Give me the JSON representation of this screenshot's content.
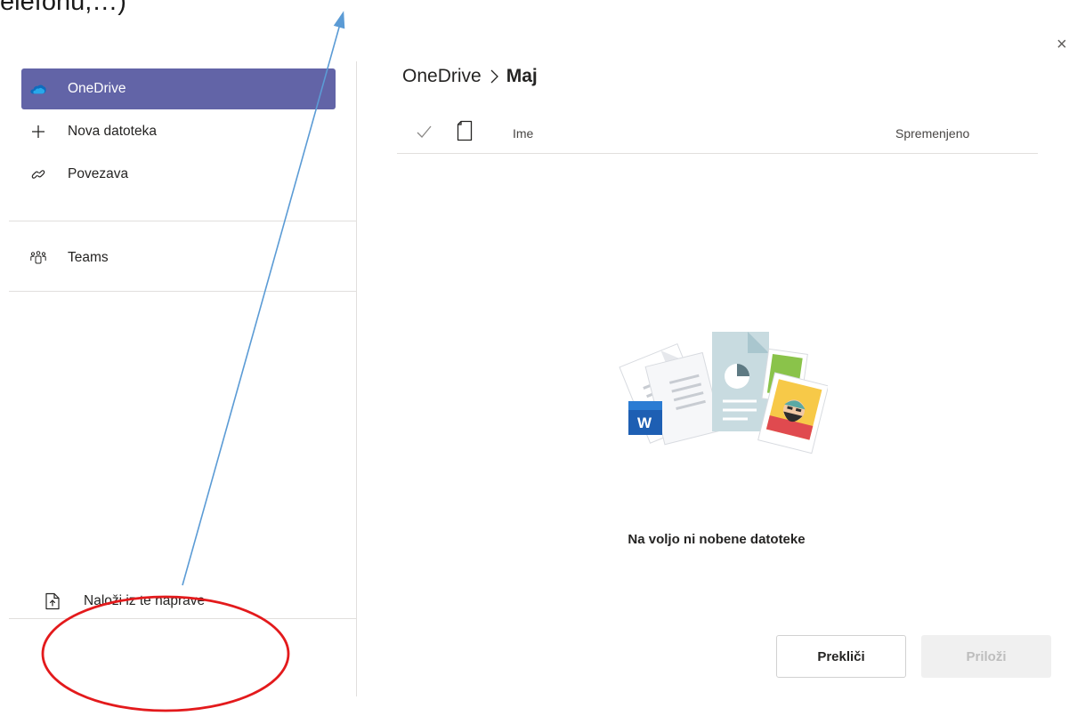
{
  "annotation": {
    "text": "telefonu,…)"
  },
  "close_label": "×",
  "nav": {
    "items": [
      {
        "label": "OneDrive",
        "icon": "onedrive-cloud-icon",
        "active": true
      },
      {
        "label": "Nova datoteka",
        "icon": "plus-icon",
        "active": false
      },
      {
        "label": "Povezava",
        "icon": "link-icon",
        "active": false
      }
    ],
    "teams": {
      "label": "Teams",
      "icon": "teams-icon"
    },
    "upload": {
      "label": "Naloži iz te naprave",
      "icon": "upload-file-icon"
    }
  },
  "breadcrumb": {
    "root": "OneDrive",
    "current": "Maj"
  },
  "table": {
    "columns": {
      "name": "Ime",
      "modified": "Spremenjeno"
    }
  },
  "empty_state": {
    "message": "Na voljo ni nobene datoteke"
  },
  "actions": {
    "cancel": "Prekliči",
    "attach": "Priloži"
  },
  "colors": {
    "accent": "#6264a7",
    "annotation_line": "#5b9bd5",
    "annotation_circle": "#e31a1c"
  }
}
